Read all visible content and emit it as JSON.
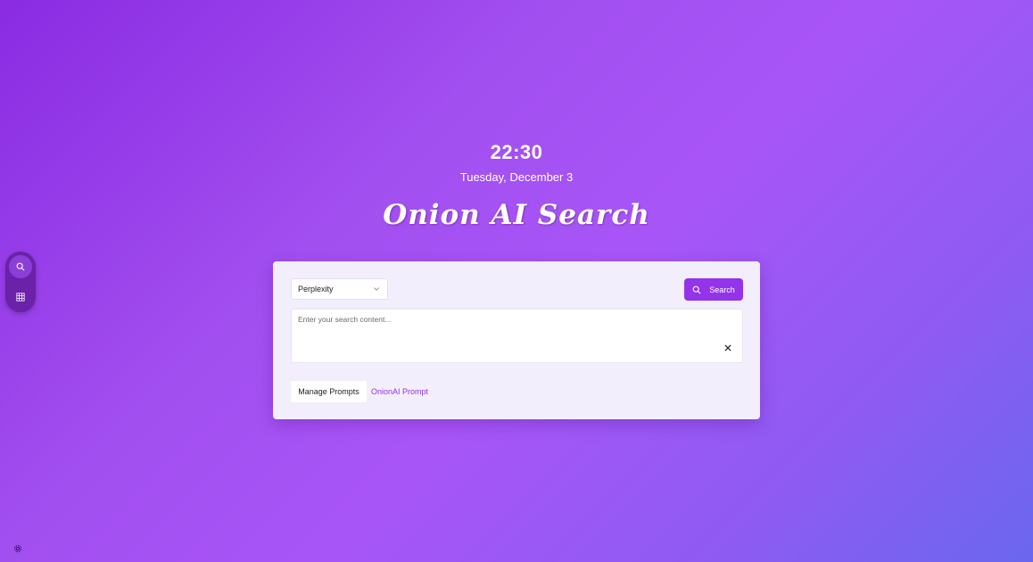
{
  "clock": {
    "time": "22:30",
    "date": "Tuesday, December 3"
  },
  "brand": {
    "title": "Onion AI Search"
  },
  "sidebar": {
    "items": [
      {
        "icon": "search-icon",
        "active": true
      },
      {
        "icon": "grid-icon",
        "active": false
      }
    ]
  },
  "search_card": {
    "engine_select": {
      "selected": "Perplexity"
    },
    "search_button": {
      "label": "Search"
    },
    "query_input": {
      "placeholder": "Enter your search content...",
      "value": ""
    },
    "manage_prompts_label": "Manage Prompts",
    "prompt_link_label": "OnionAI Prompt"
  },
  "footer": {
    "settings_icon": "gear-icon"
  },
  "colors": {
    "accent": "#9333ea",
    "rail": "#6b21a8",
    "card_bg": "#f3eefb"
  }
}
